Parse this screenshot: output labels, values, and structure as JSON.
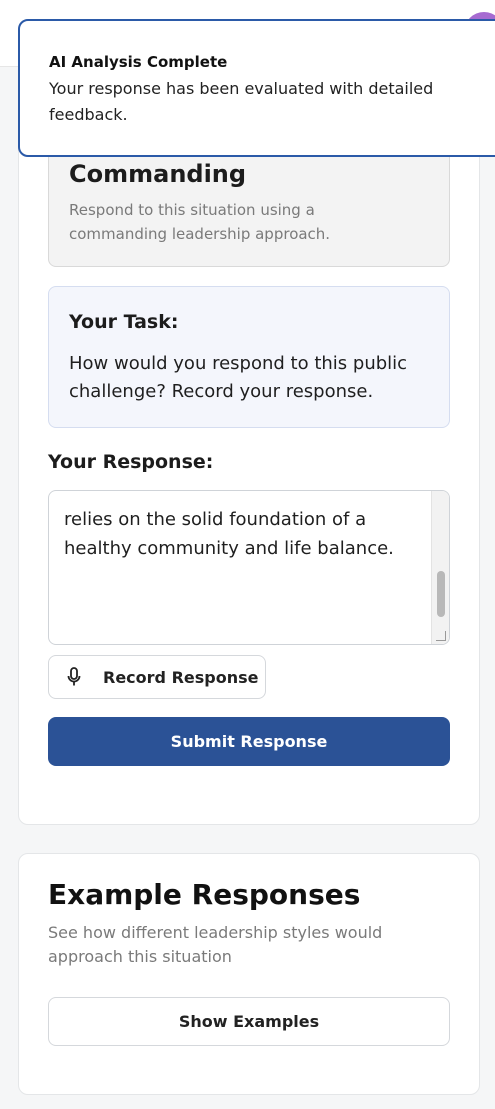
{
  "toast": {
    "title": "AI Analysis Complete",
    "message": "Your response has been evaluated with detailed feedback."
  },
  "scenario": {
    "style_name": "Commanding",
    "style_description": "Respond to this situation using a commanding leadership approach.",
    "task_title": "Your Task:",
    "task_text": "How would you respond to this public challenge? Record your response."
  },
  "response": {
    "label": "Your Response:",
    "text": "...relies on the solid foundation of a healthy community and life balance.",
    "visible_text": "relies on the solid foundation of a healthy community and life balance.",
    "record_label": "Record Response",
    "submit_label": "Submit Response"
  },
  "examples": {
    "title": "Example Responses",
    "description": "See how different leadership styles would approach this situation",
    "button_label": "Show Examples"
  },
  "colors": {
    "primary": "#2b5296",
    "toast_border": "#2b5aa8",
    "task_bg": "#f4f6fc",
    "style_bg": "#f3f3f3"
  },
  "icons": {
    "record": "microphone-icon"
  }
}
